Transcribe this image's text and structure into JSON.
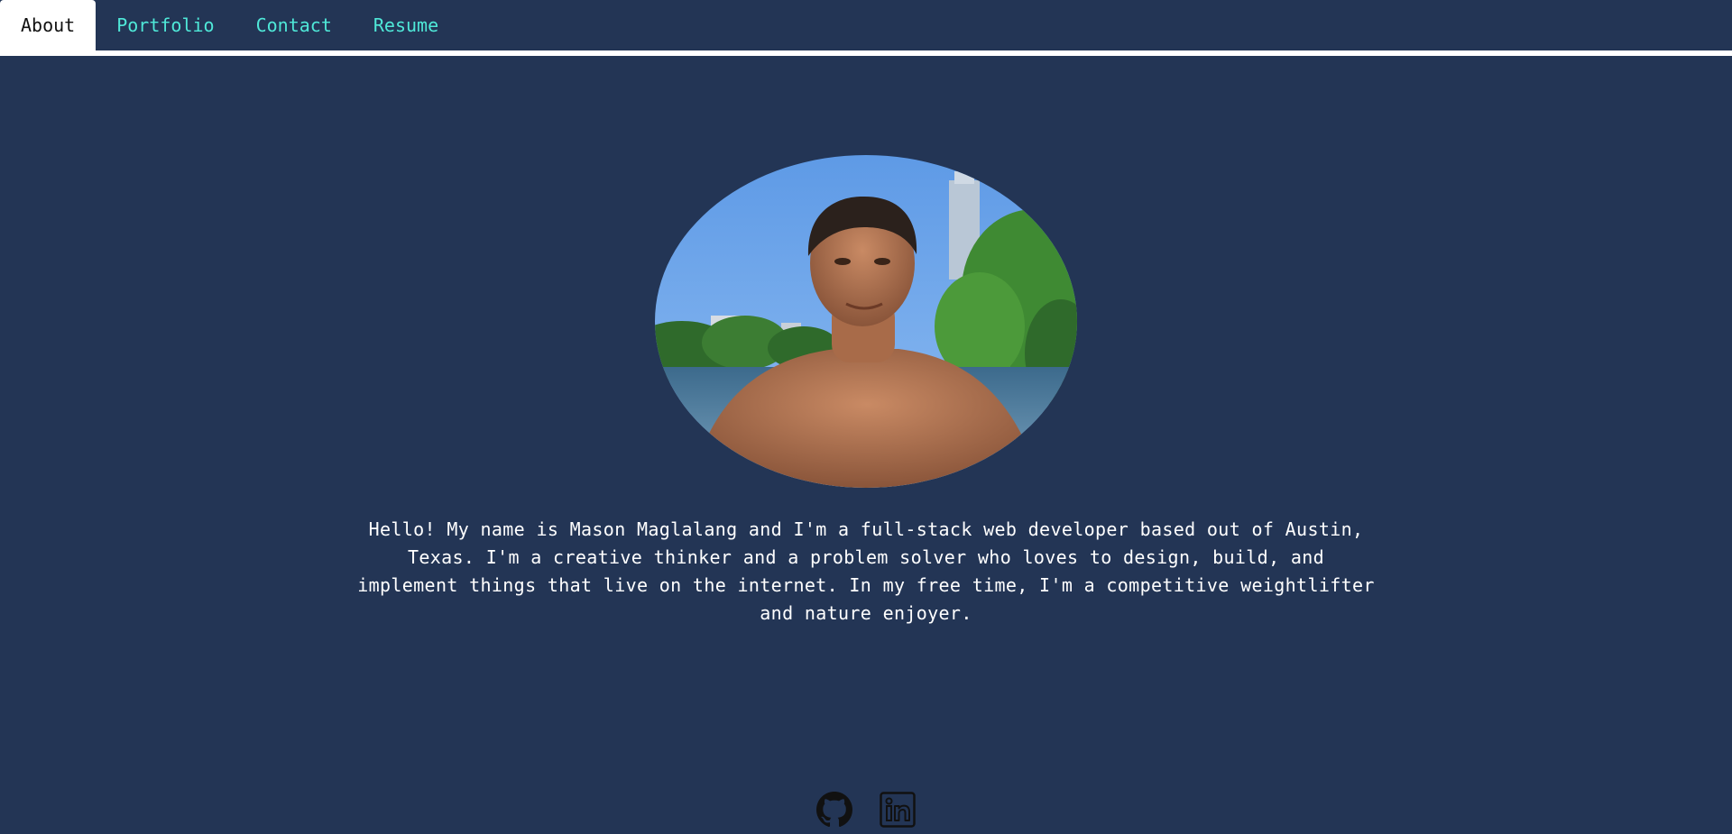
{
  "nav": {
    "tabs": [
      {
        "label": "About",
        "active": true
      },
      {
        "label": "Portfolio",
        "active": false
      },
      {
        "label": "Contact",
        "active": false
      },
      {
        "label": "Resume",
        "active": false
      }
    ]
  },
  "about": {
    "photo_icon": "profile-photo",
    "bio": "Hello! My name is Mason Maglalang and I'm a full-stack web developer based out of Austin, Texas. I'm a creative thinker and a problem solver who loves to design, build, and implement things that live on the internet. In my free time, I'm a competitive weightlifter and nature enjoyer."
  },
  "footer": {
    "socials": [
      {
        "icon": "github-icon"
      },
      {
        "icon": "linkedin-icon"
      }
    ]
  },
  "colors": {
    "background": "#233555",
    "accent": "#4fe8d8",
    "text": "#ffffff",
    "icon": "#111111"
  }
}
